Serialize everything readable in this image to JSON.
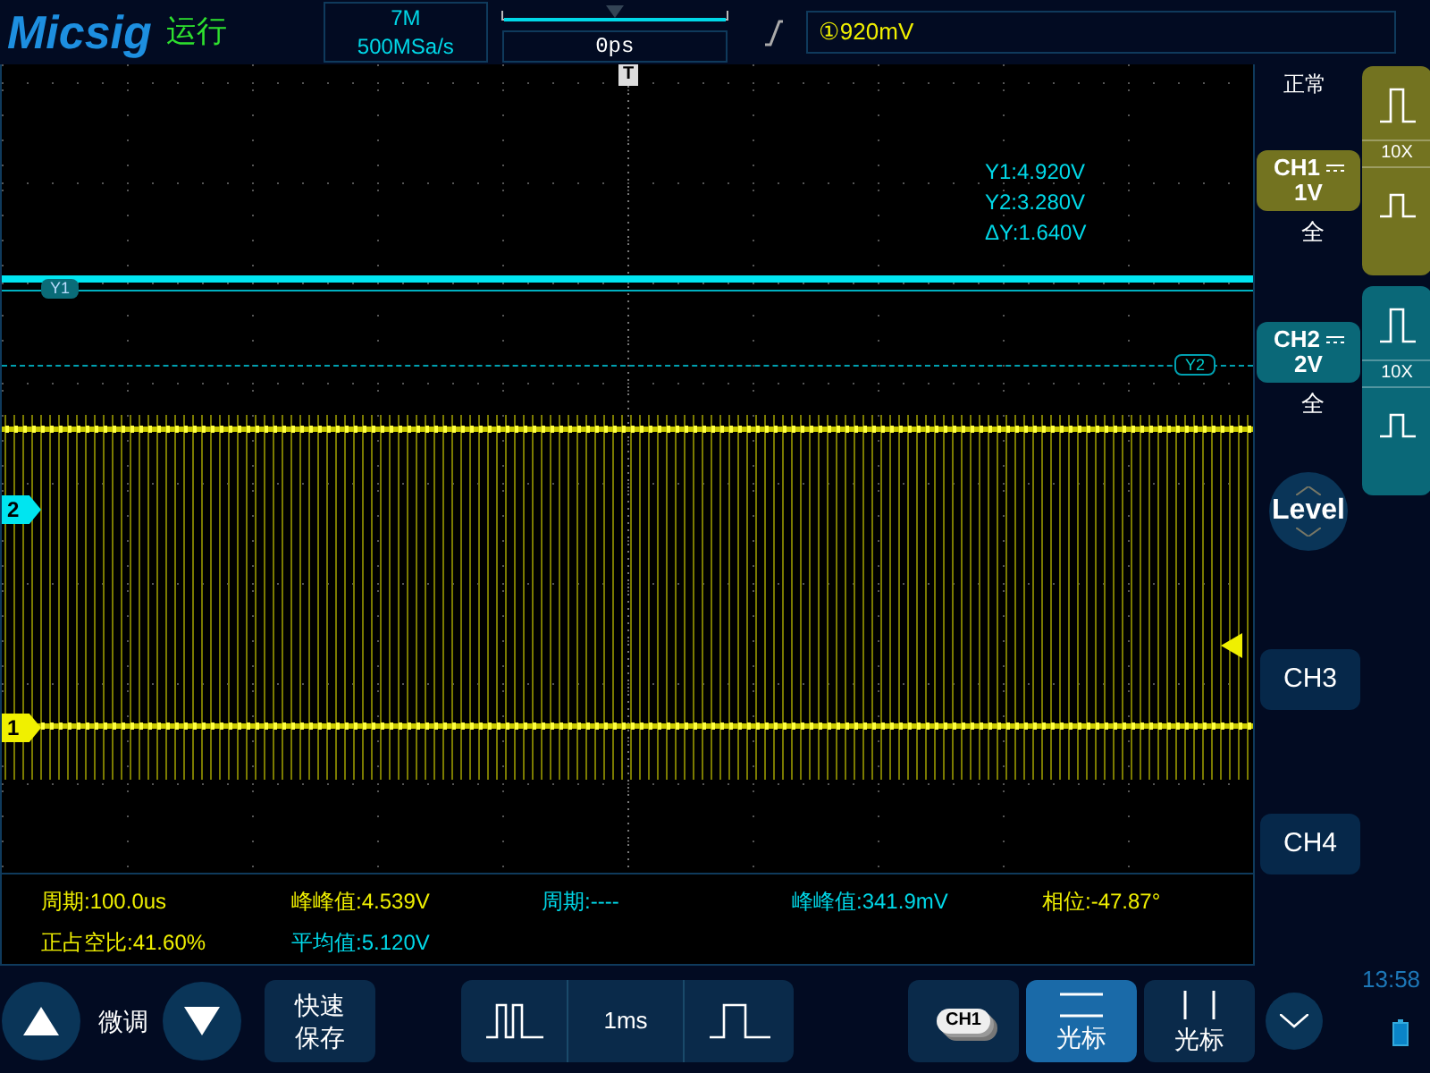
{
  "header": {
    "logo": "Micsig",
    "run_status": "运行",
    "memory_depth": "7M",
    "sample_rate": "500MSa/s",
    "time_offset": "0ps",
    "trigger_level": "①920mV"
  },
  "screen": {
    "trigger_marker": "T",
    "cursor_readout": [
      "Y1:4.920V",
      "Y2:3.280V",
      "ΔY:1.640V"
    ],
    "cursor_labels": [
      "Y1",
      "Y2"
    ],
    "channel_markers": [
      {
        "label": "2",
        "color": "#00e5f0"
      },
      {
        "label": "1",
        "color": "#f0f000"
      }
    ]
  },
  "measurements": [
    {
      "text": "周期:100.0us",
      "color": "#f0f000"
    },
    {
      "text": "峰峰值:4.539V",
      "color": "#f0f000"
    },
    {
      "text": "周期:----",
      "color": "#00d8e8"
    },
    {
      "text": "峰峰值:341.9mV",
      "color": "#00d8e8"
    },
    {
      "text": "相位:-47.87°",
      "color": "#f0f000"
    },
    {
      "text": "正占空比:41.60%",
      "color": "#f0f000"
    },
    {
      "text": "平均值:5.120V",
      "color": "#00d8e8"
    }
  ],
  "side_panel": {
    "acquisition_mode": "正常",
    "channels": [
      {
        "label": "CH1",
        "scale": "1V",
        "bandwidth": "全",
        "probe": "10X",
        "color": "#737320"
      },
      {
        "label": "CH2",
        "scale": "2V",
        "bandwidth": "全",
        "probe": "10X",
        "color": "#0a6878"
      }
    ],
    "level_button": "Level",
    "extra_channels": [
      "CH3",
      "CH4"
    ],
    "time": "13:58"
  },
  "bottom_bar": {
    "fine_adjust": "微调",
    "quick_save": "快速保存",
    "timebase": "1ms",
    "cursor_source": "CH1",
    "cursor_buttons": [
      {
        "label": "光标",
        "kind": "horizontal",
        "selected": true
      },
      {
        "label": "光标",
        "kind": "vertical",
        "selected": false
      }
    ]
  }
}
